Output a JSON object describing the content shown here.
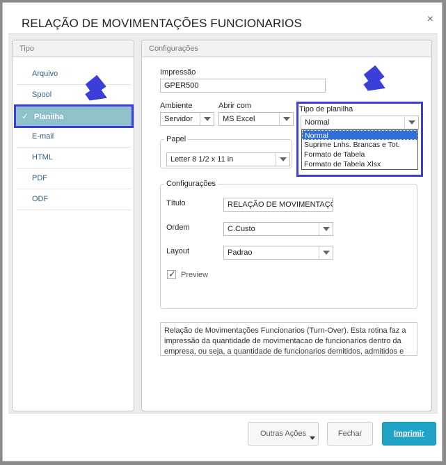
{
  "dialog": {
    "title": "RELAÇÃO DE MOVIMENTAÇÕES FUNCIONARIOS",
    "close_symbol": "×"
  },
  "type_panel": {
    "header": "Tipo",
    "items": [
      {
        "label": "Arquivo",
        "selected": false
      },
      {
        "label": "Spool",
        "selected": false
      },
      {
        "label": "Planilha",
        "selected": true
      },
      {
        "label": "E-mail",
        "selected": false
      },
      {
        "label": "HTML",
        "selected": false
      },
      {
        "label": "PDF",
        "selected": false
      },
      {
        "label": "ODF",
        "selected": false
      }
    ],
    "check_symbol": "✓"
  },
  "config_panel": {
    "header": "Configurações",
    "impressao": {
      "label": "Impressão",
      "value": "GPER500"
    },
    "ambiente": {
      "label": "Ambiente",
      "value": "Servidor"
    },
    "abrir_com": {
      "label": "Abrir com",
      "value": "MS Excel"
    },
    "tipo_planilha": {
      "label": "Tipo de planilha",
      "value": "Normal",
      "options": [
        "Normal",
        "Suprime Lnhs. Brancas e Tot.",
        "Formato de Tabela",
        "Formato de Tabela Xlsx"
      ]
    },
    "papel": {
      "legend": "Papel",
      "value": "Letter 8 1/2 x 11 in"
    },
    "configuracoes": {
      "legend": "Configurações",
      "titulo": {
        "label": "Título",
        "value": "RELAÇÃO DE MOVIMENTAÇÕE"
      },
      "ordem": {
        "label": "Ordem",
        "value": "C.Custo"
      },
      "layout": {
        "label": "Layout",
        "value": "Padrao"
      },
      "preview": {
        "label": "Preview",
        "checked": true
      }
    },
    "description": "Relação de Movimentações Funcionarios (Turn-Over). Esta rotina faz a impressão da quantidade de movimentacao de funcionarios dentro da empresa, ou seja,  a quantidade de funcionarios demitidos, admitidos e"
  },
  "footer": {
    "outras_acoes": "Outras Ações",
    "fechar": "Fechar",
    "imprimir": "Imprimir"
  },
  "colors": {
    "annotation_blue": "#3b3fd8",
    "selected_item_bg": "#8ec1c9",
    "primary_button": "#1fa3c6"
  }
}
